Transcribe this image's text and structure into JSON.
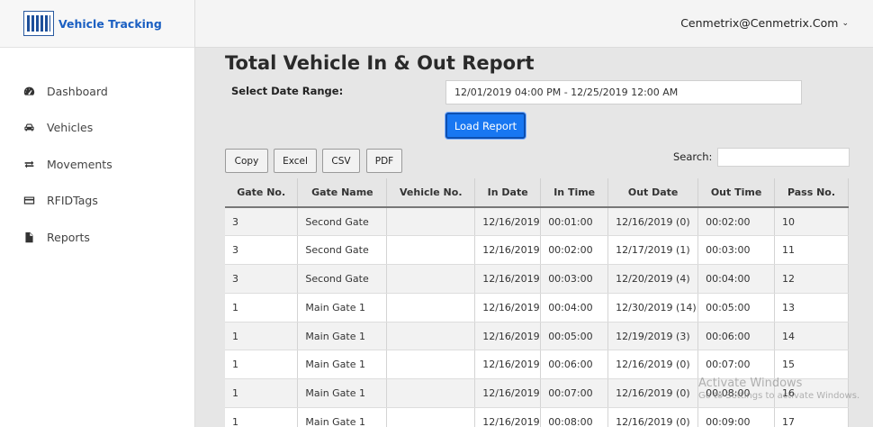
{
  "app": {
    "title": "Vehicle Tracking"
  },
  "header": {
    "user": "Cenmetrix@Cenmetrix.Com",
    "caret": "⌄"
  },
  "sidebar": {
    "items": [
      {
        "label": "Dashboard",
        "icon": "dashboard-icon"
      },
      {
        "label": "Vehicles",
        "icon": "car-icon"
      },
      {
        "label": "Movements",
        "icon": "exchange-icon"
      },
      {
        "label": "RFIDTags",
        "icon": "card-icon"
      },
      {
        "label": "Reports",
        "icon": "file-icon"
      }
    ]
  },
  "main": {
    "title": "Total Vehicle In & Out Report",
    "range_label": "Select Date Range:",
    "range_value": "12/01/2019 04:00 PM - 12/25/2019 12:00 AM",
    "load_button": "Load Report",
    "export": [
      "Copy",
      "Excel",
      "CSV",
      "PDF"
    ],
    "search_label": "Search:",
    "search_value": ""
  },
  "table": {
    "headers": [
      "Gate No.",
      "Gate Name",
      "Vehicle No.",
      "In Date",
      "In Time",
      "Out Date",
      "Out Time",
      "Pass No."
    ],
    "rows": [
      [
        "3",
        "Second Gate",
        "",
        "12/16/2019",
        "00:01:00",
        "12/16/2019 (0)",
        "00:02:00",
        "10"
      ],
      [
        "3",
        "Second Gate",
        "",
        "12/16/2019",
        "00:02:00",
        "12/17/2019 (1)",
        "00:03:00",
        "11"
      ],
      [
        "3",
        "Second Gate",
        "",
        "12/16/2019",
        "00:03:00",
        "12/20/2019 (4)",
        "00:04:00",
        "12"
      ],
      [
        "1",
        "Main Gate 1",
        "",
        "12/16/2019",
        "00:04:00",
        "12/30/2019 (14)",
        "00:05:00",
        "13"
      ],
      [
        "1",
        "Main Gate 1",
        "",
        "12/16/2019",
        "00:05:00",
        "12/19/2019 (3)",
        "00:06:00",
        "14"
      ],
      [
        "1",
        "Main Gate 1",
        "",
        "12/16/2019",
        "00:06:00",
        "12/16/2019 (0)",
        "00:07:00",
        "15"
      ],
      [
        "1",
        "Main Gate 1",
        "",
        "12/16/2019",
        "00:07:00",
        "12/16/2019 (0)",
        "00:08:00",
        "16"
      ],
      [
        "1",
        "Main Gate 1",
        "",
        "12/16/2019",
        "00:08:00",
        "12/16/2019 (0)",
        "00:09:00",
        "17"
      ]
    ]
  },
  "watermark": {
    "line1": "Activate Windows",
    "line2": "Go to Settings to activate Windows."
  }
}
